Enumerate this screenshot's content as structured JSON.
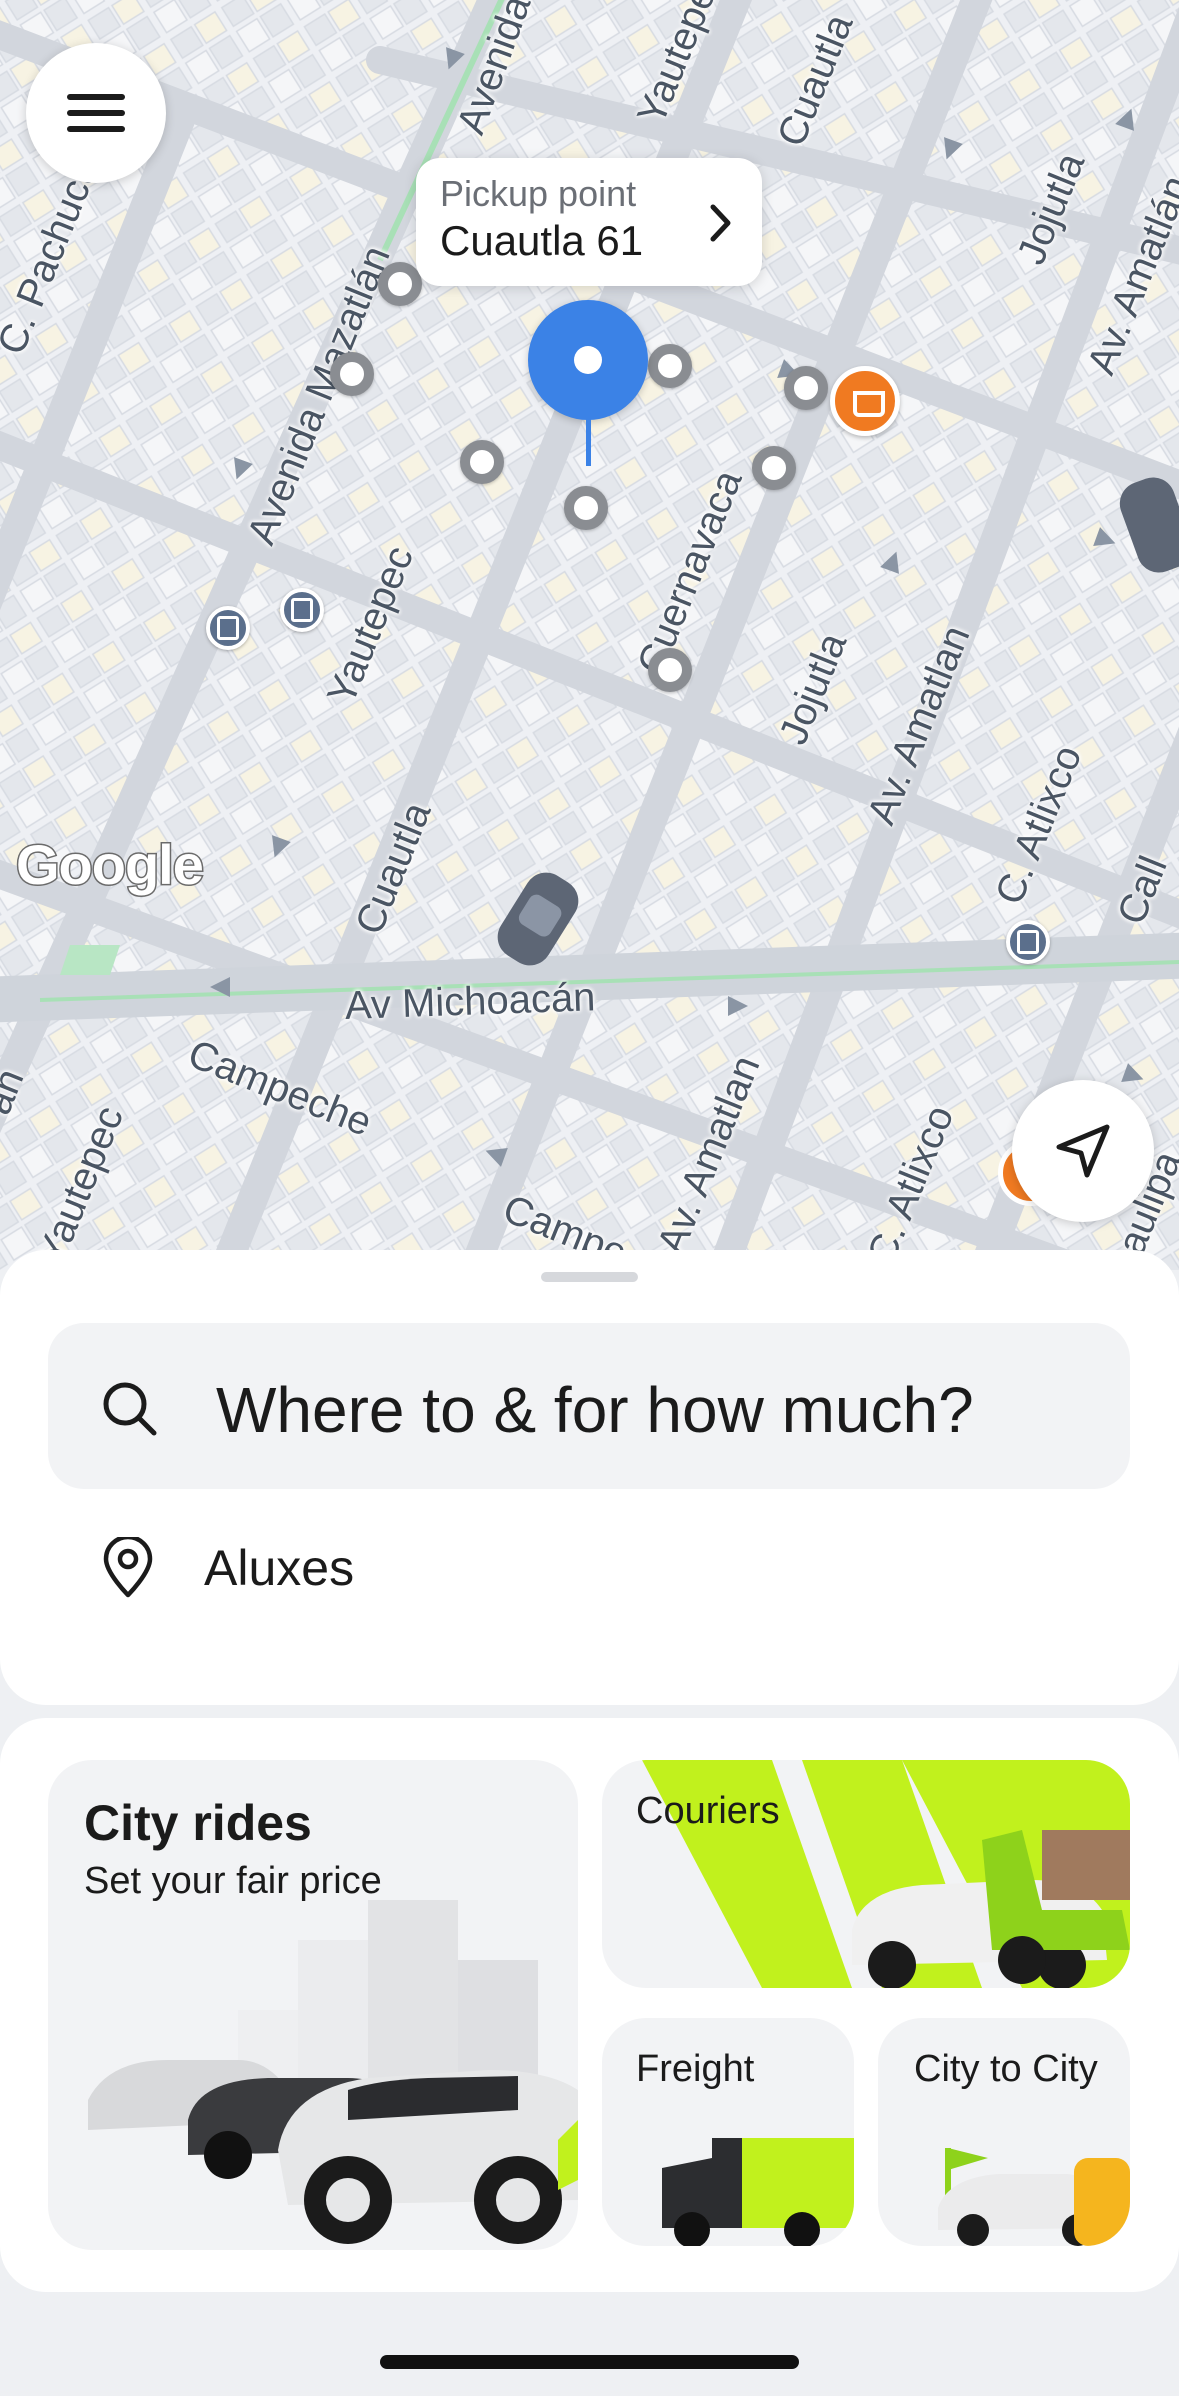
{
  "map": {
    "attribution": "Google",
    "streets": [
      {
        "key": "avenida_top",
        "text": "Avenida"
      },
      {
        "key": "yautepec_top",
        "text": "Yautepec"
      },
      {
        "key": "cuautla_top",
        "text": "Cuautla"
      },
      {
        "key": "pachuca",
        "text": "C. Pachuca"
      },
      {
        "key": "avenida_mazatlan",
        "text": "Avenida Mazatlán"
      },
      {
        "key": "jojutla_top",
        "text": "Jojutla"
      },
      {
        "key": "av_amatlan_top",
        "text": "Av. Amatlán"
      },
      {
        "key": "yautepec_mid",
        "text": "Yautepec"
      },
      {
        "key": "cuernavaca",
        "text": "Cuernavaca"
      },
      {
        "key": "jojutla_mid",
        "text": "Jojutla"
      },
      {
        "key": "av_amatlan_mid",
        "text": "Av. Amatlan"
      },
      {
        "key": "atlixco_mid",
        "text": "C. Atlixco"
      },
      {
        "key": "cuautla_low",
        "text": "Cuautla"
      },
      {
        "key": "michoacan",
        "text": "Av Michoacán"
      },
      {
        "key": "campeche",
        "text": "Campeche"
      },
      {
        "key": "campeche2",
        "text": "Campe"
      },
      {
        "key": "av_amatlan_low",
        "text": "Av. Amatlan"
      },
      {
        "key": "atlixco_low",
        "text": "C. Atlixco"
      },
      {
        "key": "yautepec_low",
        "text": "Yautepec"
      },
      {
        "key": "tamaulipas",
        "text": "aulipa"
      },
      {
        "key": "an_left",
        "text": "an"
      },
      {
        "key": "call_right",
        "text": "Call"
      }
    ],
    "pickup": {
      "label": "Pickup point",
      "value": "Cuautla 61"
    },
    "accent": "#3b82e6",
    "poi_color": "#f07a21"
  },
  "search": {
    "placeholder": "Where to & for how much?"
  },
  "saved_place": {
    "label": "Aluxes"
  },
  "services": {
    "city_rides": {
      "title": "City rides",
      "subtitle": "Set your fair price"
    },
    "couriers": {
      "title": "Couriers"
    },
    "freight": {
      "title": "Freight"
    },
    "city_to_city": {
      "title": "City to City"
    },
    "brand_color": "#c1f11d"
  }
}
